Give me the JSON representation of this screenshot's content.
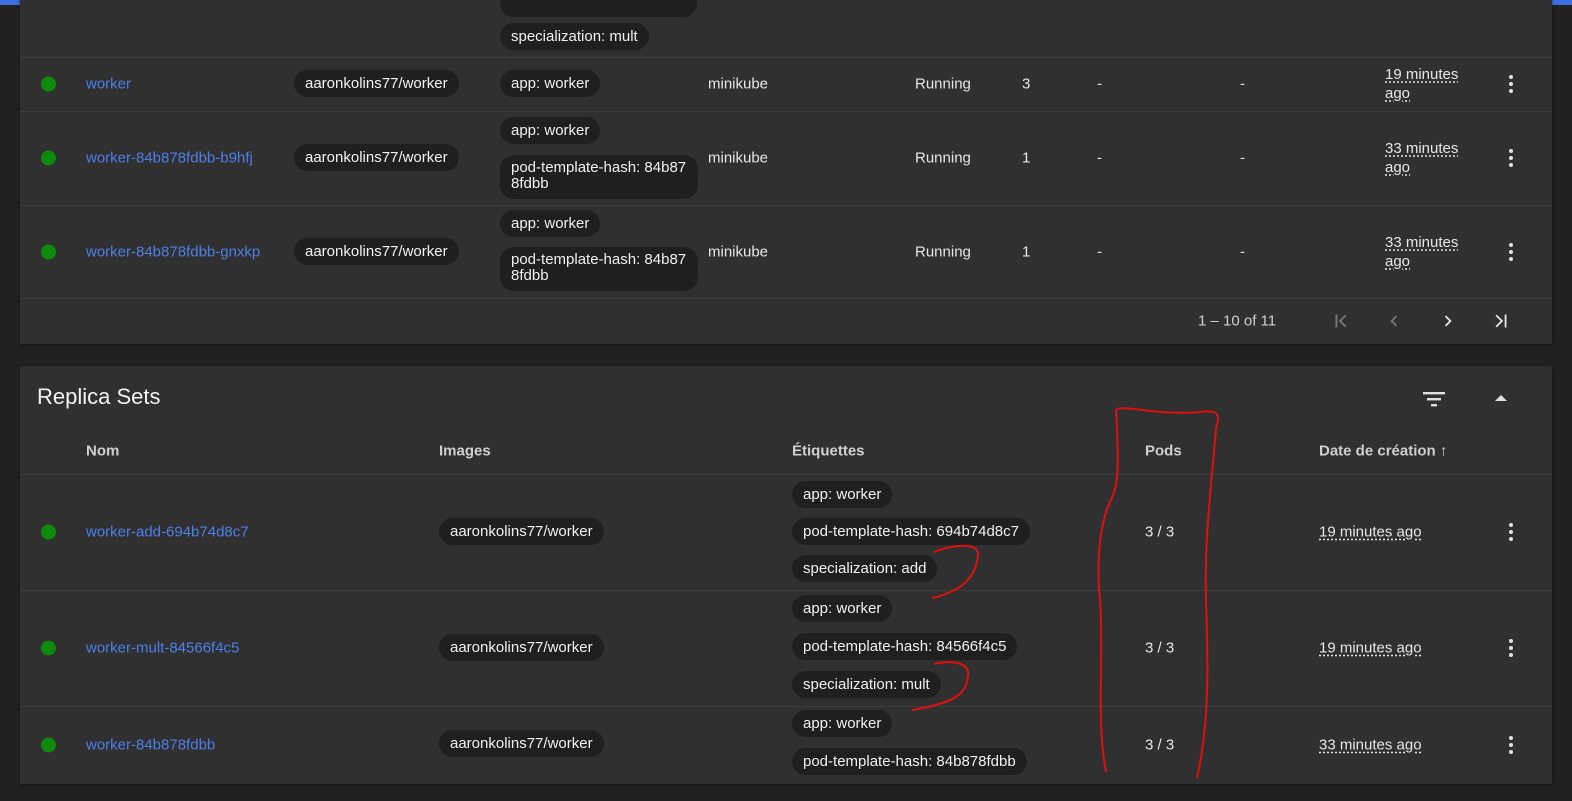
{
  "pods_table": {
    "partial_row": {
      "label": "specialization: mult"
    },
    "rows": [
      {
        "name": "worker",
        "image": "aaronkolins77/worker",
        "labels": [
          "app: worker"
        ],
        "node": "minikube",
        "status": "Running",
        "restarts": "3",
        "cpu": "-",
        "memory": "-",
        "created": "19 minutes ago"
      },
      {
        "name": "worker-84b878fdbb-b9hfj",
        "image": "aaronkolins77/worker",
        "labels": [
          "app: worker",
          "pod-template-hash: 84b878fdbb"
        ],
        "node": "minikube",
        "status": "Running",
        "restarts": "1",
        "cpu": "-",
        "memory": "-",
        "created": "33 minutes ago"
      },
      {
        "name": "worker-84b878fdbb-gnxkp",
        "image": "aaronkolins77/worker",
        "labels": [
          "app: worker",
          "pod-template-hash: 84b878fdbb"
        ],
        "node": "minikube",
        "status": "Running",
        "restarts": "1",
        "cpu": "-",
        "memory": "-",
        "created": "33 minutes ago"
      }
    ],
    "pagination": {
      "range": "1 – 10 of 11"
    }
  },
  "replica_sets": {
    "title": "Replica Sets",
    "headers": {
      "name": "Nom",
      "images": "Images",
      "labels": "Étiquettes",
      "pods": "Pods",
      "created": "Date de création",
      "sort_arrow": "↑"
    },
    "rows": [
      {
        "name": "worker-add-694b74d8c7",
        "image": "aaronkolins77/worker",
        "labels": [
          "app: worker",
          "pod-template-hash: 694b74d8c7",
          "specialization: add"
        ],
        "pods": "3 / 3",
        "created": "19 minutes ago"
      },
      {
        "name": "worker-mult-84566f4c5",
        "image": "aaronkolins77/worker",
        "labels": [
          "app: worker",
          "pod-template-hash: 84566f4c5",
          "specialization: mult"
        ],
        "pods": "3 / 3",
        "created": "19 minutes ago"
      },
      {
        "name": "worker-84b878fdbb",
        "image": "aaronkolins77/worker",
        "labels": [
          "app: worker",
          "pod-template-hash: 84b878fdbb"
        ],
        "pods": "3 / 3",
        "created": "33 minutes ago"
      }
    ]
  },
  "colors": {
    "status_ok": "#0b8a0b",
    "link": "#4d7fe8",
    "annotation": "#e01010",
    "accent": "#3d6fe0"
  },
  "icons": [
    "filter-icon",
    "collapse-icon",
    "first-page-icon",
    "prev-page-icon",
    "next-page-icon",
    "last-page-icon",
    "more-vert-icon"
  ]
}
